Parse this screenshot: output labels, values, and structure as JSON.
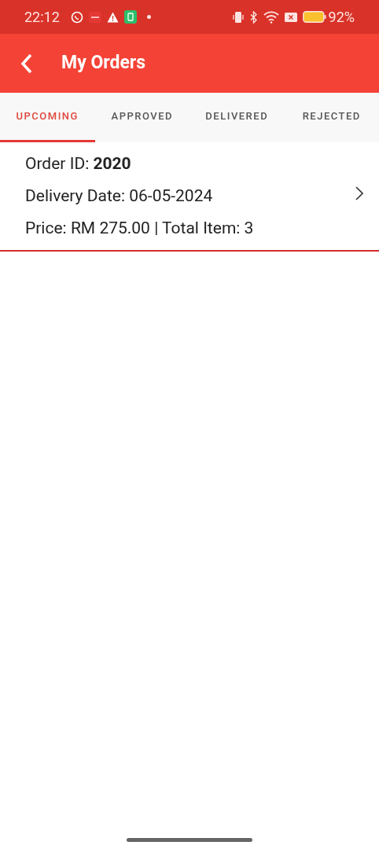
{
  "status_bar": {
    "time": "22:12",
    "battery": "92%"
  },
  "app_bar": {
    "title": "My Orders"
  },
  "tabs": [
    {
      "label": "UPCOMING",
      "selected": true
    },
    {
      "label": "APPROVED",
      "selected": false
    },
    {
      "label": "DELIVERED",
      "selected": false
    },
    {
      "label": "REJECTED",
      "selected": false
    }
  ],
  "orders": [
    {
      "id_line": "Order ID: **2020**",
      "date_line": "Delivery Date: 06-05-2024",
      "price_line": "Price: RM 275.00 | Total Item: 3"
    }
  ]
}
